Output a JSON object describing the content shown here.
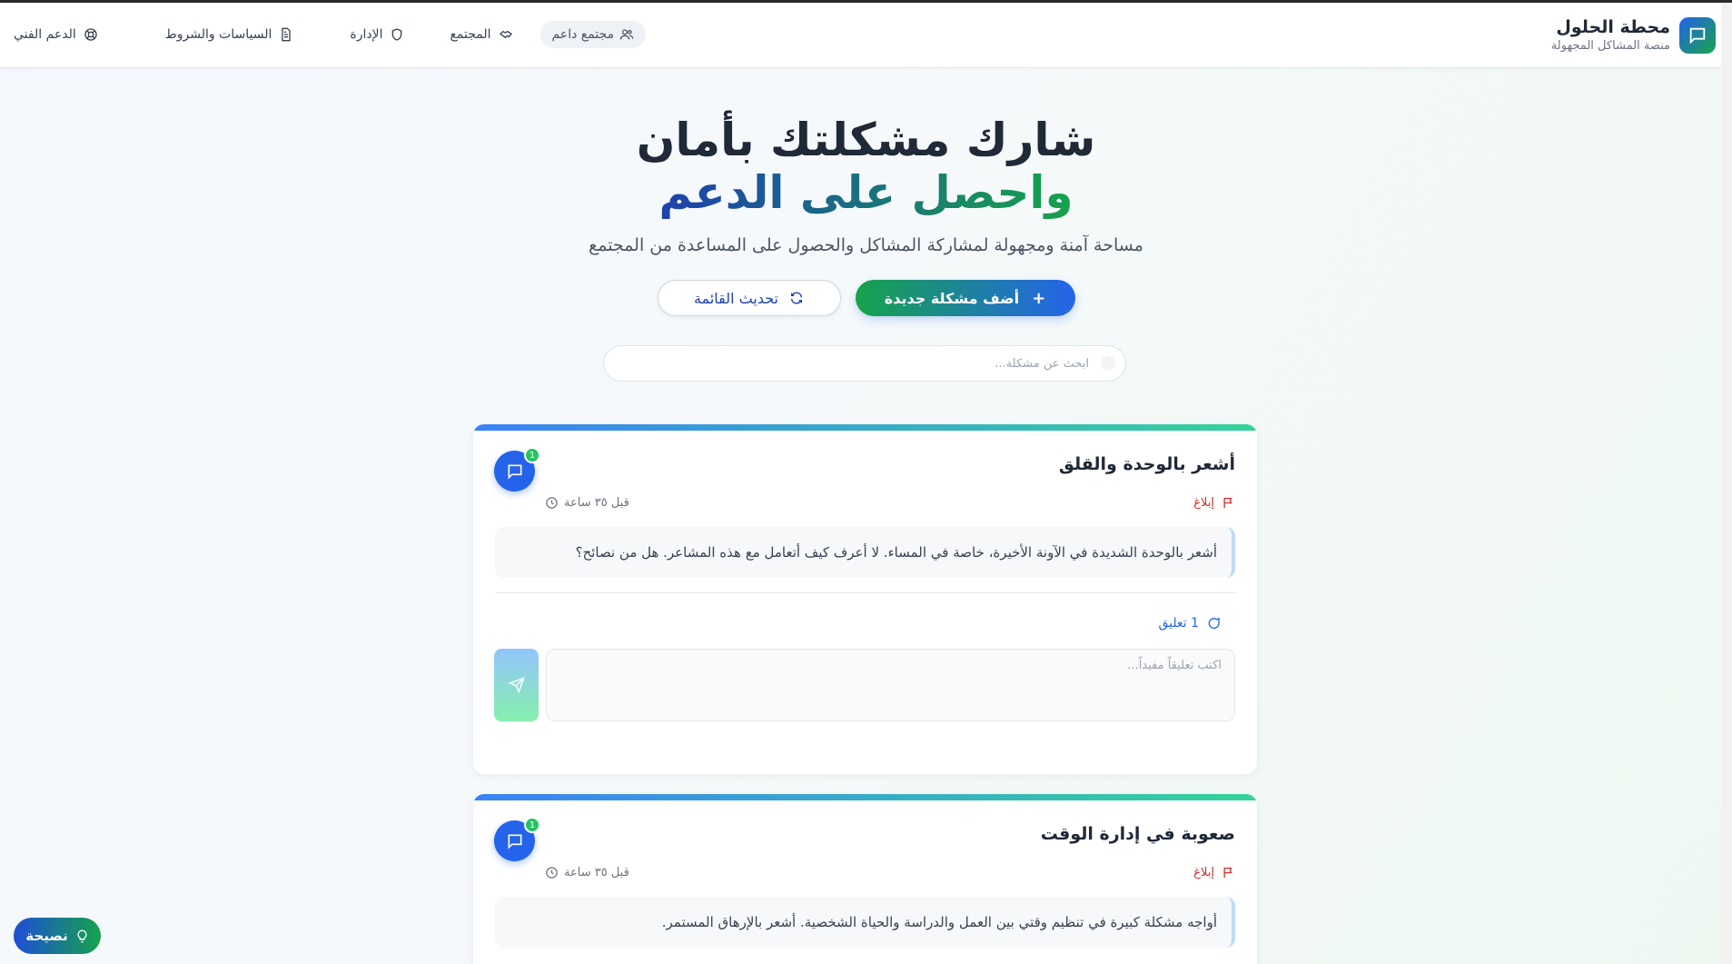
{
  "brand": {
    "title": "محطة الحلول",
    "subtitle": "منصة المشاكل المجهولة"
  },
  "nav": {
    "items": [
      {
        "label": "الدعم الفني",
        "icon": "lifebuoy-icon"
      },
      {
        "label": "السياسات والشروط",
        "icon": "document-icon"
      },
      {
        "label": "الإدارة",
        "icon": "shield-icon"
      },
      {
        "label": "المجتمع",
        "icon": "handshake-icon"
      }
    ],
    "community_button": "مجتمع داعم"
  },
  "hero": {
    "line1": "شارك مشكلتك بأمان",
    "line2": "واحصل على الدعم",
    "subtitle": "مساحة آمنة ومجهولة لمشاركة المشاكل والحصول على المساعدة من المجتمع"
  },
  "actions": {
    "add_problem": "أضف مشكلة جديدة",
    "refresh": "تحديث القائمة"
  },
  "search": {
    "placeholder": "ابحث عن مشكلة..."
  },
  "posts": [
    {
      "title": "أشعر بالوحدة والقلق",
      "report": "إبلاغ",
      "time": "قبل ٣٥ ساعة",
      "body": "أشعر بالوحدة الشديدة في الآونة الأخيرة، خاصة في المساء. لا أعرف كيف أتعامل مع هذه المشاعر. هل من نصائح؟",
      "comment_count": "1",
      "comments_label": "1 تعليق",
      "comment_placeholder": "اكتب تعليقاً مفيداً..."
    },
    {
      "title": "صعوبة في إدارة الوقت",
      "report": "إبلاغ",
      "time": "قبل ٣٥ ساعة",
      "body": "أواجه مشكلة كبيرة في تنظيم وقتي بين العمل والدراسة والحياة الشخصية. أشعر بالإرهاق المستمر.",
      "comment_count": "1"
    }
  ],
  "tip_button": "نصيحة",
  "colors": {
    "primary": "#2563eb",
    "accent": "#16a34a",
    "danger": "#dc2626"
  }
}
